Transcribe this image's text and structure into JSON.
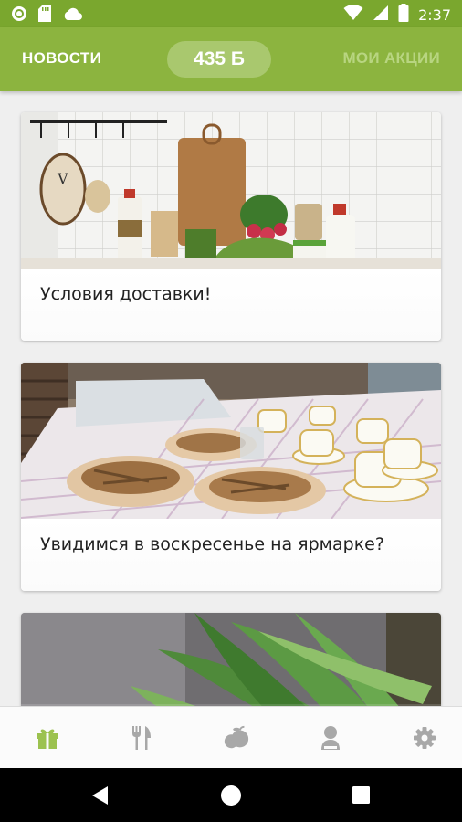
{
  "status_bar": {
    "time": "2:37",
    "icons": [
      "circle-notification-icon",
      "sd-card-icon",
      "cloud-icon",
      "wifi-icon",
      "cellular-signal-icon",
      "battery-icon"
    ]
  },
  "header": {
    "tab_news": "НОВОСТИ",
    "points": "435 Б",
    "tab_promos": "МОИ АКЦИИ",
    "colors": {
      "bar": "#8cb43f",
      "status_bar": "#7aa72e",
      "pill": "#a9c86e",
      "inactive_tab": "#b8d581"
    }
  },
  "news": [
    {
      "title": "Условия доставки!",
      "image": "kitchen-shelf-image"
    },
    {
      "title": "Увидимся в воскресенье на ярмарке?",
      "image": "fair-table-food-image"
    },
    {
      "title": "",
      "image": "wild-garlic-leaves-image"
    }
  ],
  "bottom_nav": {
    "items": [
      {
        "icon": "gift-icon",
        "active": true
      },
      {
        "icon": "fork-knife-icon",
        "active": false
      },
      {
        "icon": "fruit-icon",
        "active": false
      },
      {
        "icon": "person-icon",
        "active": false
      },
      {
        "icon": "gear-icon",
        "active": false
      }
    ],
    "active_color": "#9cc24f",
    "inactive_color": "#a8a8a8"
  },
  "system_nav": {
    "buttons": [
      "back-icon",
      "home-icon",
      "recents-icon"
    ]
  }
}
